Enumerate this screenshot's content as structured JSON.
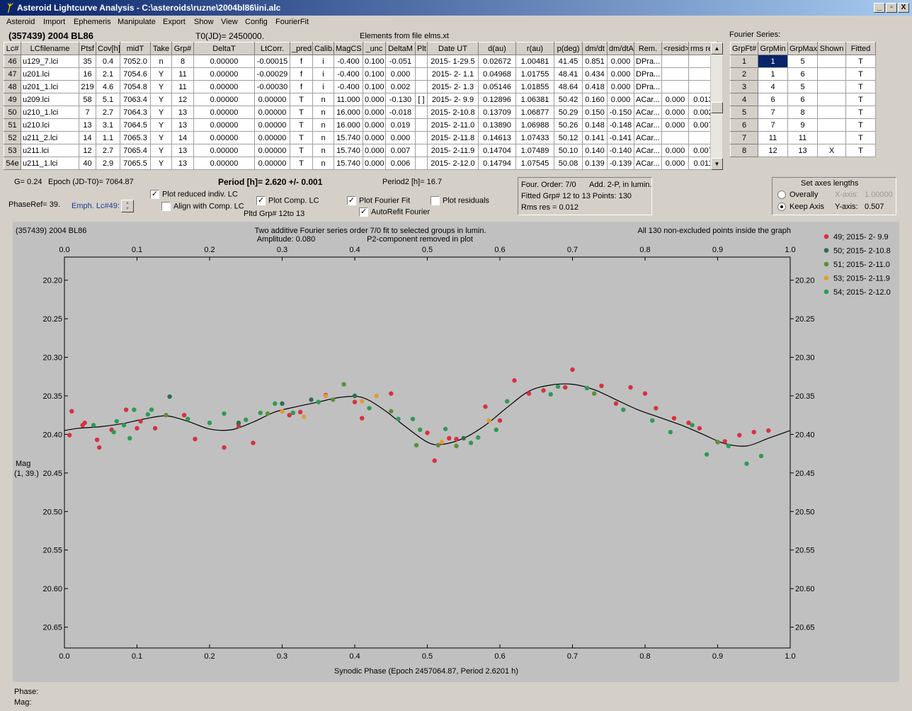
{
  "window": {
    "title": "Asteroid Lightcurve Analysis - C:\\asteroids\\ruzne\\2004bl86\\ini.alc",
    "icon": "app-icon",
    "min": "_",
    "max": "▫",
    "close": "X"
  },
  "menu": [
    "Asteroid",
    "Import",
    "Ephemeris",
    "Manipulate",
    "Export",
    "Show",
    "View",
    "Config",
    "FourierFit"
  ],
  "header": {
    "object": "(357439) 2004 BL86",
    "t0": "T0(JD)= 2450000.",
    "elements": "Elements from file elms.xt",
    "fourier_series": "Fourier Series:"
  },
  "lc_table": {
    "columns": [
      "Lc#",
      "LCfilename",
      "Ptsf",
      "Cov[h]",
      "midT",
      "Take",
      "Grp#",
      "DeltaT",
      "LtCorr.",
      "_pred.",
      "Calib.",
      "MagCS",
      "_unc",
      "DeltaM",
      "Plt",
      "Date UT",
      "d(au)",
      "r(au)",
      "p(deg)",
      "dm/dt",
      "dm/dtA",
      "Rem.",
      "<resid>",
      "rms res"
    ],
    "rows": [
      [
        "46",
        "u129_7.lci",
        "35",
        "0.4",
        "7052.0",
        "n",
        "8",
        "0.00000",
        "-0.00015",
        "f",
        "i",
        "-0.400",
        "0.100",
        "-0.051",
        "",
        "2015- 1-29.5",
        "0.02672",
        "1.00481",
        "41.45",
        "0.851",
        "0.000",
        "DPra...",
        "",
        ""
      ],
      [
        "47",
        "u201.lci",
        "16",
        "2.1",
        "7054.6",
        "Y",
        "11",
        "0.00000",
        "-0.00029",
        "f",
        "i",
        "-0.400",
        "0.100",
        "0.000",
        "",
        "2015- 2- 1.1",
        "0.04968",
        "1.01755",
        "48.41",
        "0.434",
        "0.000",
        "DPra...",
        "",
        ""
      ],
      [
        "48",
        "u201_1.lci",
        "219",
        "4.6",
        "7054.8",
        "Y",
        "11",
        "0.00000",
        "-0.00030",
        "f",
        "i",
        "-0.400",
        "0.100",
        "0.002",
        "",
        "2015- 2- 1.3",
        "0.05146",
        "1.01855",
        "48.64",
        "0.418",
        "0.000",
        "DPra...",
        "",
        ""
      ],
      [
        "49",
        "u209.lci",
        "58",
        "5.1",
        "7063.4",
        "Y",
        "12",
        "0.00000",
        "0.00000",
        "T",
        "n",
        "11.000",
        "0.000",
        "-0.130",
        "[ ]",
        "2015- 2- 9.9",
        "0.12896",
        "1.06381",
        "50.42",
        "0.160",
        "0.000",
        "ACar...",
        "0.000",
        "0.013"
      ],
      [
        "50",
        "u210_1.lci",
        "7",
        "2.7",
        "7064.3",
        "Y",
        "13",
        "0.00000",
        "0.00000",
        "T",
        "n",
        "16.000",
        "0.000",
        "-0.018",
        "",
        "2015- 2-10.8",
        "0.13709",
        "1.06877",
        "50.29",
        "0.150",
        "-0.150",
        "ACar...",
        "0.000",
        "0.002"
      ],
      [
        "51",
        "u210.lci",
        "13",
        "3.1",
        "7064.5",
        "Y",
        "13",
        "0.00000",
        "0.00000",
        "T",
        "n",
        "16.000",
        "0.000",
        "0.019",
        "",
        "2015- 2-11.0",
        "0.13890",
        "1.06988",
        "50.26",
        "0.148",
        "-0.148",
        "ACar...",
        "0.000",
        "0.007"
      ],
      [
        "52",
        "u211_2.lci",
        "14",
        "1.1",
        "7065.3",
        "Y",
        "14",
        "0.00000",
        "0.00000",
        "T",
        "n",
        "15.740",
        "0.000",
        "0.000",
        "",
        "2015- 2-11.8",
        "0.14613",
        "1.07433",
        "50.12",
        "0.141",
        "-0.141",
        "ACar...",
        "",
        ""
      ],
      [
        "53",
        "u211.lci",
        "12",
        "2.7",
        "7065.4",
        "Y",
        "13",
        "0.00000",
        "0.00000",
        "T",
        "n",
        "15.740",
        "0.000",
        "0.007",
        "",
        "2015- 2-11.9",
        "0.14704",
        "1.07489",
        "50.10",
        "0.140",
        "-0.140",
        "ACar...",
        "0.000",
        "0.007"
      ],
      [
        "54e",
        "u211_1.lci",
        "40",
        "2.9",
        "7065.5",
        "Y",
        "13",
        "0.00000",
        "0.00000",
        "T",
        "n",
        "15.740",
        "0.000",
        "0.006",
        "",
        "2015- 2-12.0",
        "0.14794",
        "1.07545",
        "50.08",
        "0.139",
        "-0.139",
        "ACar...",
        "0.000",
        "0.011"
      ]
    ]
  },
  "fourier_table": {
    "columns": [
      "GrpFt#",
      "GrpMin",
      "GrpMax",
      "Shown",
      "Fitted"
    ],
    "rows": [
      [
        "1",
        "1",
        "5",
        "",
        "T"
      ],
      [
        "2",
        "1",
        "6",
        "",
        "T"
      ],
      [
        "3",
        "4",
        "5",
        "",
        "T"
      ],
      [
        "4",
        "6",
        "6",
        "",
        "T"
      ],
      [
        "5",
        "7",
        "8",
        "",
        "T"
      ],
      [
        "6",
        "7",
        "9",
        "",
        "T"
      ],
      [
        "7",
        "11",
        "11",
        "",
        "T"
      ],
      [
        "8",
        "12",
        "13",
        "X",
        "T"
      ]
    ]
  },
  "controls": {
    "g": "G= 0.24",
    "epoch": "Epoch (JD-T0)= 7064.87",
    "period": "Period [h]= 2.620 +/- 0.001",
    "period2": "Period2 [h]= 16.7",
    "phaseref": "PhaseRef= 39.",
    "emph": "Emph. Lc#49:",
    "plot_reduced": "Plot reduced indiv. LC",
    "align_comp": "Align with Comp. LC",
    "plot_comp": "Plot Comp. LC",
    "pltd_grp": "Pltd Grp#  12to   13",
    "plot_fourier": "Plot Fourier Fit",
    "autorefit": "AutoRefit Fourier",
    "plot_residuals": "Plot residuals",
    "four_order": "Four. Order:  7/0",
    "add2p": "Add. 2-P, in lumin.",
    "fitted_grp": "Fitted Grp# 12 to 13 Points: 130",
    "rms": "Rms res     = 0.012",
    "axes_title": "Set axes lengths",
    "overally": "Overally",
    "keep_axis": "Keep Axis",
    "xaxis_label": "X-axis:",
    "xaxis_val": "1.00000",
    "yaxis_label": "Y-axis:",
    "yaxis_val": "0.507"
  },
  "status": {
    "phase": "Phase:",
    "mag": "Mag:"
  },
  "chart_data": {
    "type": "scatter",
    "object_label": "(357439) 2004 BL86",
    "title": "Two additive Fourier series order 7/0 fit to selected groups in lumin.",
    "subtitle_left": "Amplitude: 0.080",
    "subtitle_right": "P2-component removed in plot",
    "note": "All 130 non-excluded points inside the graph",
    "xlabel": "Synodic Phase (Epoch 2457064.87, Period 2.6201 h)",
    "ylabel": "Mag",
    "ylabel2": "(1, 39.)",
    "xlim": [
      0,
      1
    ],
    "ylim": [
      20.17,
      20.677
    ],
    "y_inverted": true,
    "x_ticks": [
      "0.0",
      "0.1",
      "0.2",
      "0.3",
      "0.4",
      "0.5",
      "0.6",
      "0.7",
      "0.8",
      "0.9",
      "1.0"
    ],
    "y_ticks": [
      "20.20",
      "20.25",
      "20.30",
      "20.35",
      "20.40",
      "20.45",
      "20.50",
      "20.55",
      "20.60",
      "20.65"
    ],
    "fit_curve": {
      "x": [
        0.0,
        0.02,
        0.05,
        0.08,
        0.11,
        0.14,
        0.17,
        0.2,
        0.23,
        0.26,
        0.29,
        0.32,
        0.35,
        0.38,
        0.41,
        0.44,
        0.47,
        0.5,
        0.52,
        0.55,
        0.58,
        0.61,
        0.64,
        0.67,
        0.7,
        0.73,
        0.76,
        0.79,
        0.82,
        0.85,
        0.88,
        0.91,
        0.94,
        0.97,
        1.0
      ],
      "y": [
        20.395,
        20.392,
        20.39,
        20.386,
        20.38,
        20.376,
        20.383,
        20.393,
        20.394,
        20.384,
        20.371,
        20.364,
        20.358,
        20.352,
        20.352,
        20.368,
        20.39,
        20.41,
        20.413,
        20.405,
        20.388,
        20.365,
        20.344,
        20.336,
        20.335,
        20.342,
        20.355,
        20.368,
        20.378,
        20.388,
        20.4,
        20.412,
        20.415,
        20.405,
        20.395
      ]
    },
    "series": [
      {
        "name": "49; 2015- 2- 9.9",
        "color": "#d6313f",
        "x": [
          0.007,
          0.01,
          0.025,
          0.028,
          0.045,
          0.048,
          0.065,
          0.085,
          0.1,
          0.105,
          0.125,
          0.165,
          0.18,
          0.22,
          0.24,
          0.26,
          0.31,
          0.325,
          0.36,
          0.4,
          0.41,
          0.45,
          0.5,
          0.51,
          0.53,
          0.54,
          0.58,
          0.6,
          0.62,
          0.64,
          0.66,
          0.69,
          0.7,
          0.74,
          0.76,
          0.78,
          0.8,
          0.815,
          0.84,
          0.86,
          0.875,
          0.91,
          0.93,
          0.95,
          0.97
        ],
        "y": [
          20.401,
          20.37,
          20.388,
          20.385,
          20.407,
          20.417,
          20.394,
          20.368,
          20.392,
          20.383,
          20.392,
          20.375,
          20.406,
          20.417,
          20.389,
          20.411,
          20.375,
          20.371,
          20.349,
          20.358,
          20.379,
          20.347,
          20.398,
          20.434,
          20.405,
          20.406,
          20.364,
          20.382,
          20.33,
          20.347,
          20.343,
          20.339,
          20.316,
          20.337,
          20.36,
          20.339,
          20.347,
          20.366,
          20.379,
          20.385,
          20.392,
          20.409,
          20.401,
          20.397,
          20.395
        ]
      },
      {
        "name": "50; 2015- 2-10.8",
        "color": "#2e6e4c",
        "x": [
          0.145,
          0.24,
          0.3,
          0.34,
          0.4,
          0.55
        ],
        "y": [
          20.351,
          20.385,
          20.36,
          20.355,
          20.35,
          20.405
        ]
      },
      {
        "name": "51; 2015- 2-11.0",
        "color": "#5c8e3a",
        "x": [
          0.14,
          0.28,
          0.37,
          0.385,
          0.45,
          0.485,
          0.515,
          0.54,
          0.73,
          0.9
        ],
        "y": [
          20.375,
          20.373,
          20.355,
          20.335,
          20.37,
          20.414,
          20.414,
          20.415,
          20.347,
          20.41
        ]
      },
      {
        "name": "53; 2015- 2-11.9",
        "color": "#e09a3a",
        "x": [
          0.3,
          0.33,
          0.36,
          0.41,
          0.43,
          0.52,
          0.585
        ],
        "y": [
          20.37,
          20.377,
          20.35,
          20.357,
          20.35,
          20.41,
          20.382
        ]
      },
      {
        "name": "54; 2015- 2-12.0",
        "color": "#2f9a52",
        "x": [
          0.04,
          0.068,
          0.072,
          0.082,
          0.09,
          0.096,
          0.115,
          0.12,
          0.17,
          0.2,
          0.22,
          0.25,
          0.27,
          0.29,
          0.315,
          0.35,
          0.42,
          0.46,
          0.48,
          0.49,
          0.525,
          0.56,
          0.57,
          0.595,
          0.61,
          0.67,
          0.68,
          0.72,
          0.77,
          0.81,
          0.835,
          0.865,
          0.885,
          0.915,
          0.94,
          0.96
        ],
        "y": [
          20.388,
          20.397,
          20.383,
          20.388,
          20.405,
          20.368,
          20.374,
          20.368,
          20.38,
          20.385,
          20.373,
          20.381,
          20.372,
          20.36,
          20.372,
          20.358,
          20.366,
          20.38,
          20.38,
          20.394,
          20.393,
          20.411,
          20.404,
          20.394,
          20.357,
          20.348,
          20.338,
          20.34,
          20.368,
          20.382,
          20.397,
          20.388,
          20.426,
          20.415,
          20.438,
          20.428
        ]
      }
    ]
  }
}
